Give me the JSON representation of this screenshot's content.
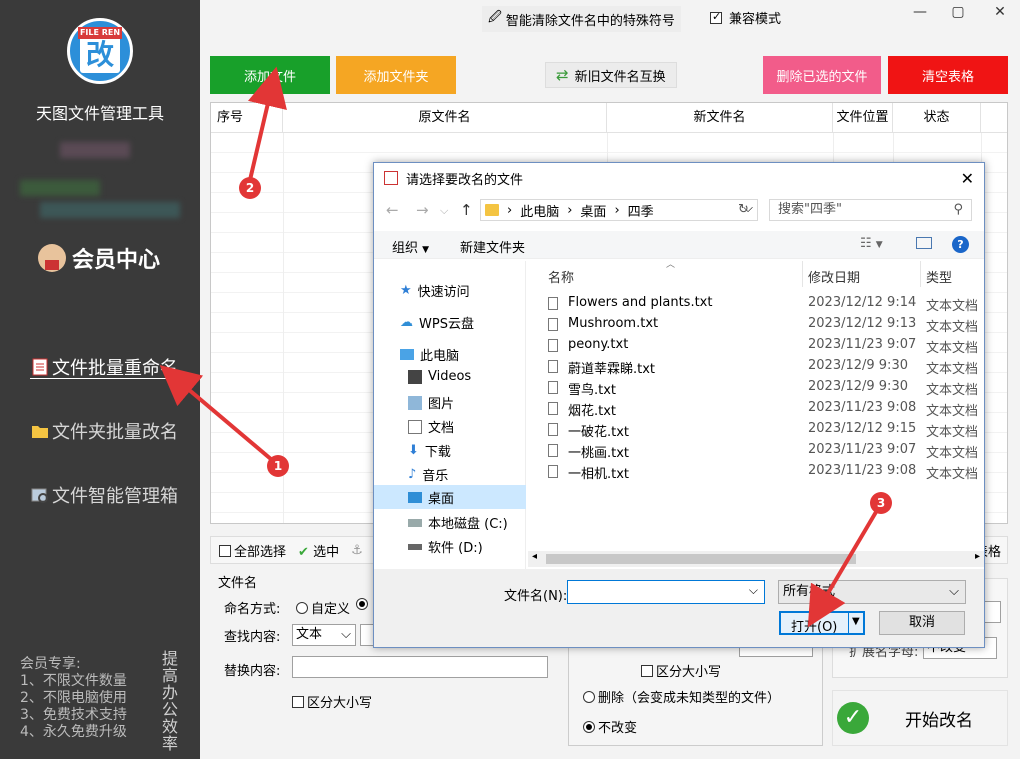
{
  "sidebar": {
    "logo_tag": "FILE REN",
    "logo_char": "改",
    "app_title": "天图文件管理工具",
    "member": "会员中心",
    "nav": [
      {
        "label": "文件批量重命名"
      },
      {
        "label": "文件夹批量改名"
      },
      {
        "label": "文件智能管理箱"
      }
    ],
    "perks": [
      "会员专享:",
      "1、不限文件数量",
      "2、不限电脑使用",
      "3、免费技术支持",
      "4、永久免费升级"
    ],
    "vertical_text": "提高办公效率"
  },
  "titlebar": {
    "special_chars": "智能清除文件名中的特殊符号",
    "compat_mode": "兼容模式",
    "minimize": "—",
    "maximize": "▢",
    "close": "✕"
  },
  "toolbar": {
    "add_file": "添加文件",
    "add_folder": "添加文件夹",
    "swap_names": "新旧文件名互换",
    "delete_selected": "删除已选的文件",
    "clear_table": "清空表格",
    "colors": {
      "green": "#18a02a",
      "orange": "#f5a623",
      "pink": "#f25c8a",
      "red": "#f01414"
    }
  },
  "table": {
    "columns": [
      "序号",
      "原文件名",
      "新文件名",
      "文件位置",
      "状态"
    ]
  },
  "bottombar": {
    "select_all": "全部选择",
    "select": "选中",
    "table_tail": "表格"
  },
  "options": {
    "section": "文件名",
    "naming_mode": "命名方式:",
    "custom": "自定义",
    "find_label": "查找内容:",
    "find_type": "文本",
    "replace_label": "替换内容:",
    "case_sensitive": "区分大小写",
    "mid_case": "区分大小写",
    "delete_opt": "删除（会变成未知类型的文件）",
    "no_change": "不改变",
    "ext_case": "扩展名字母:",
    "ext_value": "不改变",
    "start": "开始改名"
  },
  "dialog": {
    "title": "请选择要改名的文件",
    "breadcrumb": [
      "此电脑",
      "桌面",
      "四季"
    ],
    "search_placeholder": "搜索\"四季\"",
    "organize": "组织",
    "new_folder": "新建文件夹",
    "nav": [
      {
        "label": "快速访问"
      },
      {
        "label": "WPS云盘"
      },
      {
        "label": "此电脑"
      },
      {
        "label": "Videos"
      },
      {
        "label": "图片"
      },
      {
        "label": "文档"
      },
      {
        "label": "下载"
      },
      {
        "label": "音乐"
      },
      {
        "label": "桌面"
      },
      {
        "label": "本地磁盘 (C:)"
      },
      {
        "label": "软件 (D:)"
      }
    ],
    "columns": {
      "name": "名称",
      "date": "修改日期",
      "type": "类型"
    },
    "files": [
      {
        "name": "Flowers and plants.txt",
        "date": "2023/12/12 9:14",
        "type": "文本文档"
      },
      {
        "name": "Mushroom.txt",
        "date": "2023/12/12 9:13",
        "type": "文本文档"
      },
      {
        "name": "peony.txt",
        "date": "2023/11/23 9:07",
        "type": "文本文档"
      },
      {
        "name": "蔚道莘霖睇.txt",
        "date": "2023/12/9 9:30",
        "type": "文本文档"
      },
      {
        "name": "雪鸟.txt",
        "date": "2023/12/9 9:30",
        "type": "文本文档"
      },
      {
        "name": "烟花.txt",
        "date": "2023/11/23 9:08",
        "type": "文本文档"
      },
      {
        "name": "一破花.txt",
        "date": "2023/12/12 9:15",
        "type": "文本文档"
      },
      {
        "name": "一桃画.txt",
        "date": "2023/11/23 9:07",
        "type": "文本文档"
      },
      {
        "name": "一相机.txt",
        "date": "2023/11/23 9:08",
        "type": "文本文档"
      }
    ],
    "filename_label": "文件名(N):",
    "filename_value": "",
    "filetype": "所有格式",
    "open": "打开(O)",
    "cancel": "取消"
  },
  "annotations": {
    "b1": "1",
    "b2": "2",
    "b3": "3",
    "color": "#e23636"
  }
}
